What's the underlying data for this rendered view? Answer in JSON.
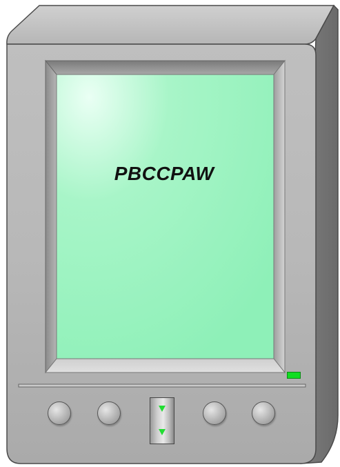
{
  "device": {
    "name": "handheld-terminal",
    "screen_text": "PBCCPAW",
    "screen_color": "#a8f5c8",
    "body_color": "#bdbdbd",
    "led_color": "#11dd22",
    "buttons": [
      "button-1",
      "button-2",
      "button-3",
      "button-4"
    ],
    "scroll_rocker": {
      "up_icon": "arrow-down-icon",
      "down_icon": "arrow-down-icon"
    }
  }
}
